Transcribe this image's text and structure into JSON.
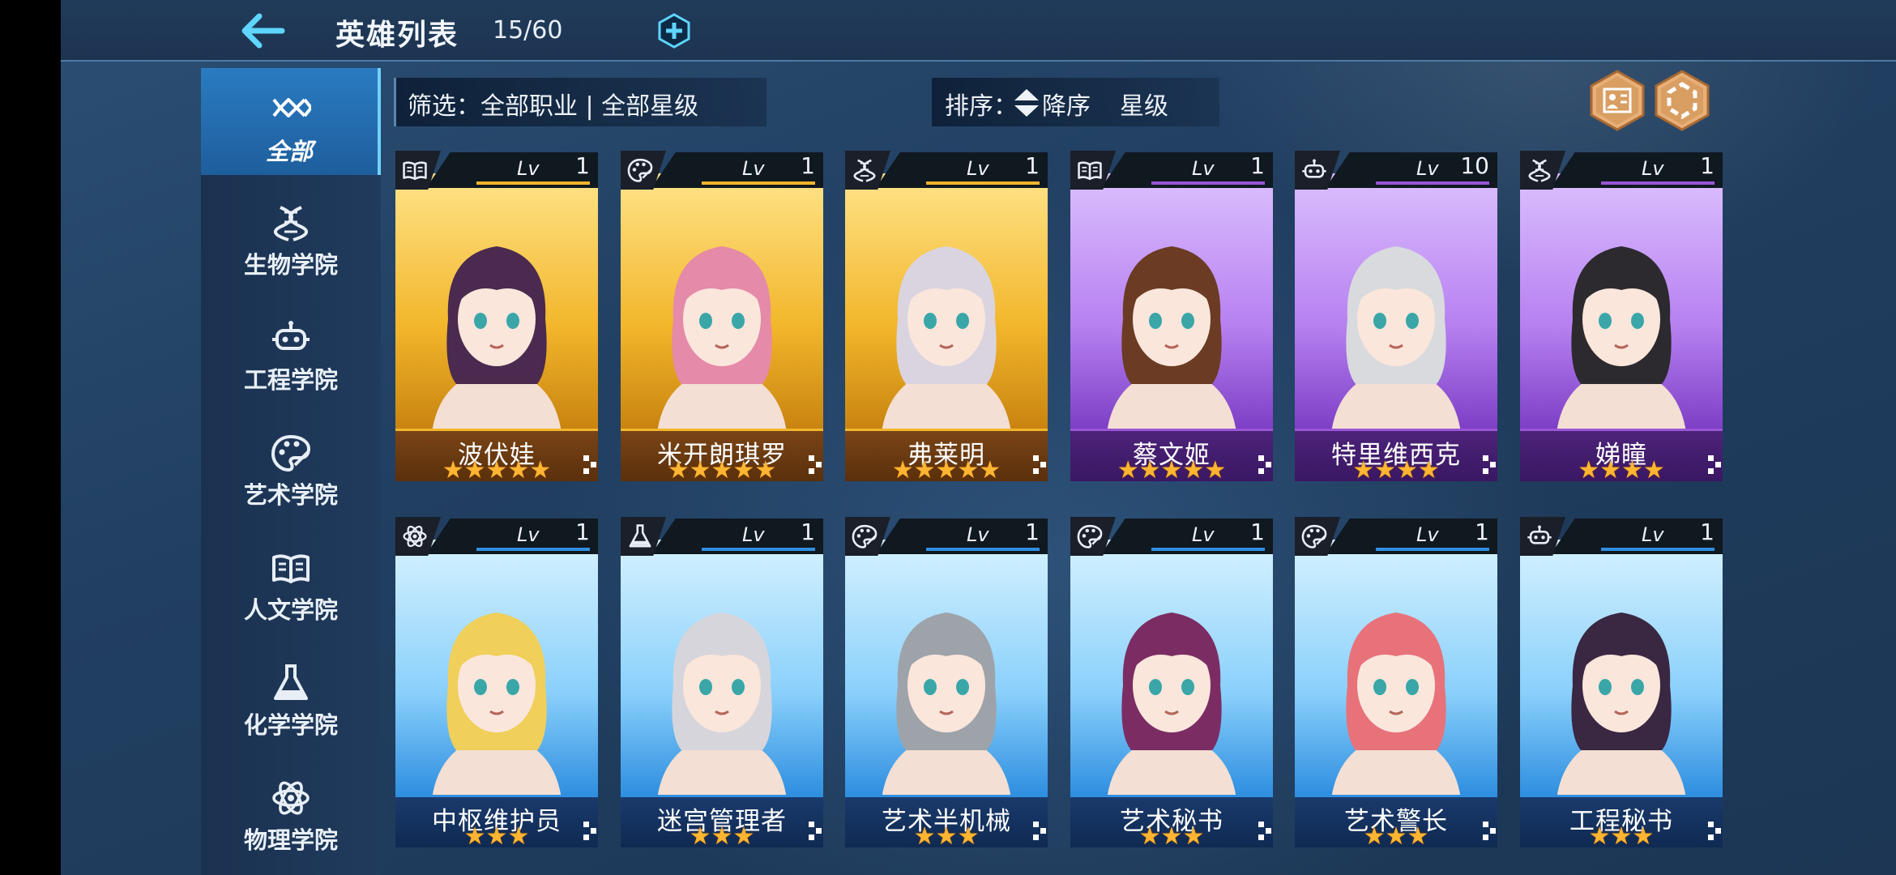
{
  "header": {
    "title": "英雄列表",
    "count": "15/60"
  },
  "sidebar": {
    "items": [
      {
        "label": "全部",
        "icon": "infinity-icon",
        "active": true
      },
      {
        "label": "生物学院",
        "icon": "dna-icon"
      },
      {
        "label": "工程学院",
        "icon": "robot-icon"
      },
      {
        "label": "艺术学院",
        "icon": "palette-icon"
      },
      {
        "label": "人文学院",
        "icon": "book-icon"
      },
      {
        "label": "化学学院",
        "icon": "flask-icon"
      },
      {
        "label": "物理学院",
        "icon": "atom-icon"
      }
    ]
  },
  "filter": {
    "text": "筛选：全部职业 | 全部星级"
  },
  "sort": {
    "label": "排序：",
    "direction": "降序",
    "key": "星级"
  },
  "level_prefix": "Lv",
  "heroes": [
    {
      "name": "波伏娃",
      "level": "1",
      "stars": 5,
      "school_icon": "book-icon",
      "rarity_color": "#f2b62b",
      "hair": "#4a2a4e"
    },
    {
      "name": "米开朗琪罗",
      "level": "1",
      "stars": 5,
      "school_icon": "palette-icon",
      "rarity_color": "#f2b62b",
      "hair": "#e58aa8"
    },
    {
      "name": "弗莱明",
      "level": "1",
      "stars": 5,
      "school_icon": "dna-icon",
      "rarity_color": "#f2b62b",
      "hair": "#d9d4df"
    },
    {
      "name": "蔡文姬",
      "level": "1",
      "stars": 5,
      "school_icon": "book-icon",
      "rarity_color": "#9a56d6",
      "hair": "#6b3b23"
    },
    {
      "name": "特里维西克",
      "level": "10",
      "stars": 4,
      "school_icon": "robot-icon",
      "rarity_color": "#9a56d6",
      "hair": "#d8dadd"
    },
    {
      "name": "娣瞳",
      "level": "1",
      "stars": 4,
      "school_icon": "dna-icon",
      "rarity_color": "#9a56d6",
      "hair": "#2c2a2e"
    },
    {
      "name": "中枢维护员",
      "level": "1",
      "stars": 3,
      "school_icon": "atom-icon",
      "rarity_color": "#2f8fe0",
      "hair": "#f0cf5a"
    },
    {
      "name": "迷宫管理者",
      "level": "1",
      "stars": 3,
      "school_icon": "flask-icon",
      "rarity_color": "#2f8fe0",
      "hair": "#d7d5dc"
    },
    {
      "name": "艺术半机械",
      "level": "1",
      "stars": 3,
      "school_icon": "palette-icon",
      "rarity_color": "#2f8fe0",
      "hair": "#9ea3aa"
    },
    {
      "name": "艺术秘书",
      "level": "1",
      "stars": 3,
      "school_icon": "palette-icon",
      "rarity_color": "#2f8fe0",
      "hair": "#7b2d63"
    },
    {
      "name": "艺术警长",
      "level": "1",
      "stars": 3,
      "school_icon": "palette-icon",
      "rarity_color": "#2f8fe0",
      "hair": "#e8727a"
    },
    {
      "name": "工程秘书",
      "level": "1",
      "stars": 3,
      "school_icon": "robot-icon",
      "rarity_color": "#2f8fe0",
      "hair": "#3a2741"
    }
  ],
  "colors": {
    "accent": "#5fd5ff",
    "star": "#ffb531",
    "bronze": "#d59a5c"
  }
}
